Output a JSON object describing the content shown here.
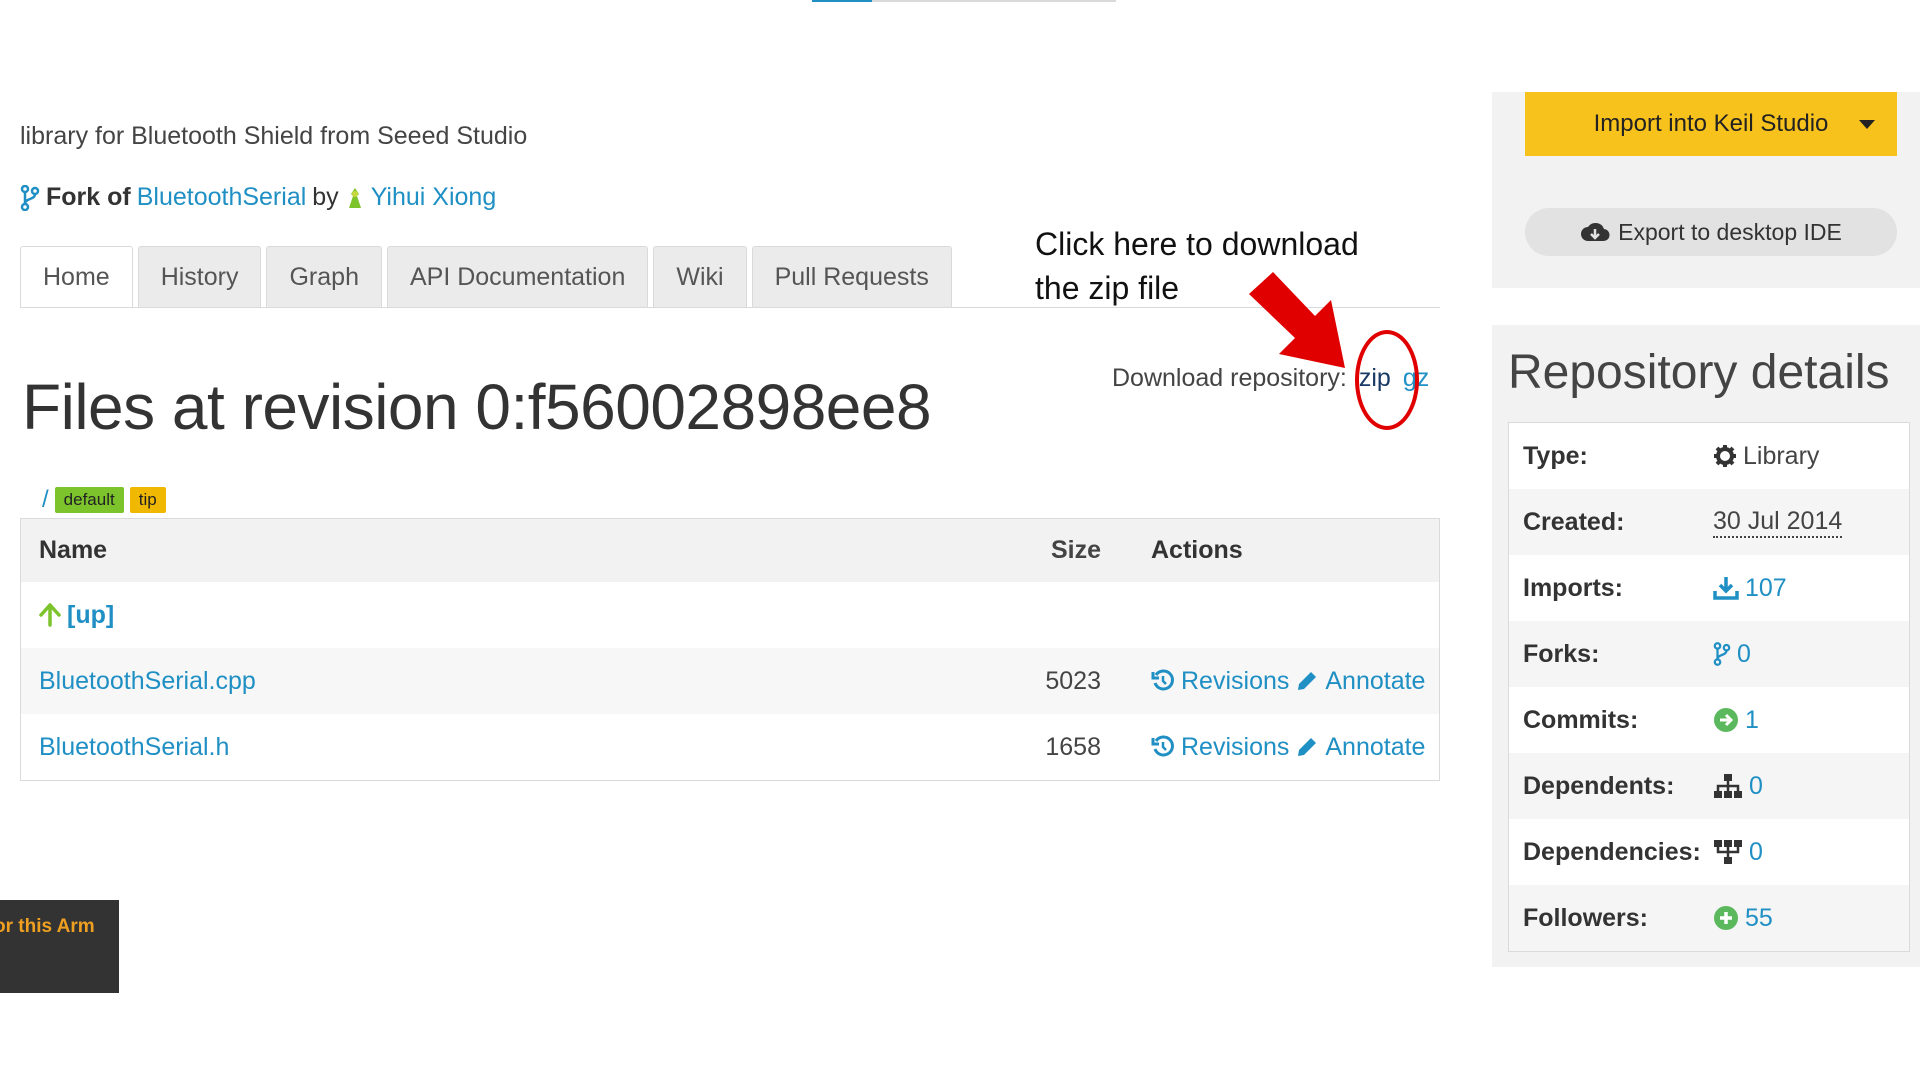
{
  "description": "library for Bluetooth Shield from Seeed Studio",
  "fork": {
    "label": "Fork of",
    "repo": "BluetoothSerial",
    "by": "by",
    "author": "Yihui Xiong"
  },
  "tabs": [
    {
      "label": "Home",
      "active": true
    },
    {
      "label": "History"
    },
    {
      "label": "Graph"
    },
    {
      "label": "API Documentation"
    },
    {
      "label": "Wiki"
    },
    {
      "label": "Pull Requests"
    }
  ],
  "page_title": "Files at revision 0:f56002898ee8",
  "download": {
    "label": "Download repository:",
    "zip": "zip",
    "gz": "gz"
  },
  "annotation": {
    "line1": "Click here to download",
    "line2": "the zip file"
  },
  "breadcrumb": {
    "root": "/",
    "badge_default": "default",
    "badge_tip": "tip"
  },
  "table": {
    "headers": {
      "name": "Name",
      "size": "Size",
      "actions": "Actions"
    },
    "up_label": "[up]",
    "files": [
      {
        "name": "BluetoothSerial.cpp",
        "size": "5023",
        "revisions": "Revisions",
        "annotate": "Annotate"
      },
      {
        "name": "BluetoothSerial.h",
        "size": "1658",
        "revisions": "Revisions",
        "annotate": "Annotate"
      }
    ]
  },
  "dark_badge": "or this Arm",
  "sidebar": {
    "import_label": "Import into Keil Studio",
    "export_label": "Export to desktop IDE",
    "details_title": "Repository details",
    "details": [
      {
        "key": "Type:",
        "value": "Library",
        "icon": "gear-icon"
      },
      {
        "key": "Created:",
        "value": "30 Jul 2014"
      },
      {
        "key": "Imports:",
        "value": "107",
        "icon": "download-icon"
      },
      {
        "key": "Forks:",
        "value": "0",
        "icon": "fork-icon"
      },
      {
        "key": "Commits:",
        "value": "1",
        "icon": "arrow-circle-icon"
      },
      {
        "key": "Dependents:",
        "value": "0",
        "icon": "hierarchy-icon"
      },
      {
        "key": "Dependencies:",
        "value": "0",
        "icon": "dependencies-icon"
      },
      {
        "key": "Followers:",
        "value": "55",
        "icon": "plus-circle-icon"
      }
    ]
  },
  "colors": {
    "link": "#1f8fc4",
    "import_button": "#f8c21c",
    "annotation_red": "#e00000",
    "badge_default": "#7dc32b",
    "badge_tip": "#f0b800"
  }
}
